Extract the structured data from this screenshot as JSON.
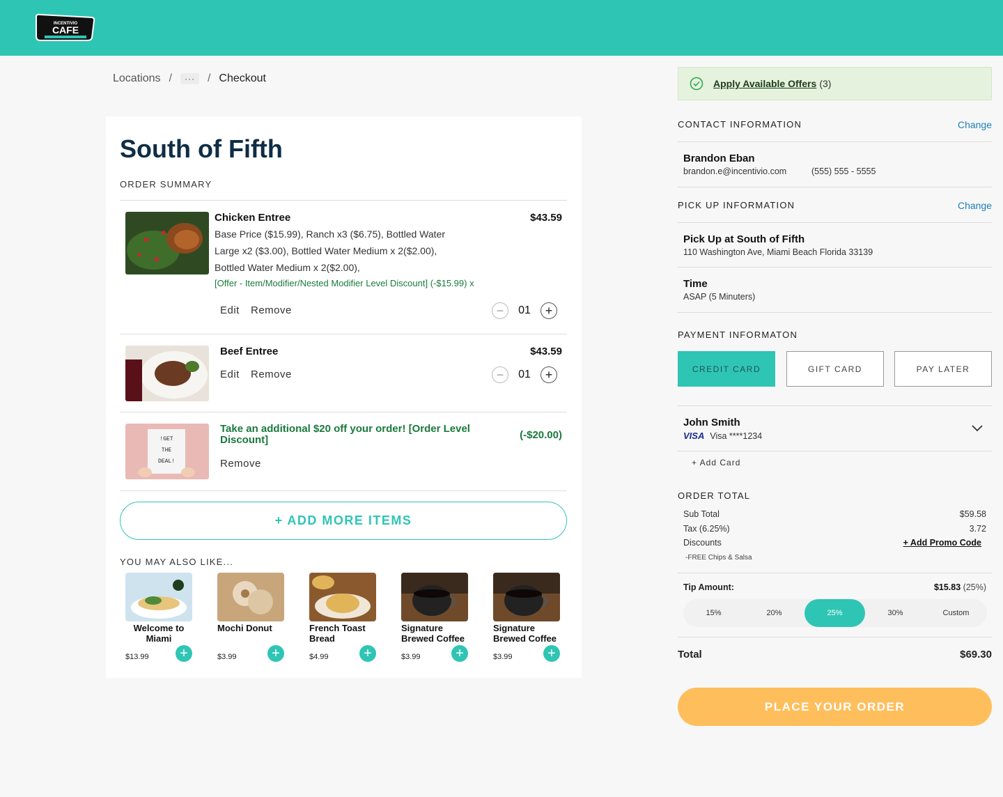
{
  "header": {
    "logo_alt": "Incentivio Cafe"
  },
  "breadcrumb": {
    "locations": "Locations",
    "sep": "/",
    "ellipsis": "···",
    "current": "Checkout"
  },
  "store": {
    "title": "South of Fifth"
  },
  "order_summary": {
    "label": "ORDER SUMMARY",
    "items": [
      {
        "name": "Chicken Entree",
        "price": "$43.59",
        "desc": "Base Price ($15.99), Ranch x3 ($6.75), Bottled Water Large x2 ($3.00), Bottled Water Medium x 2($2.00), Bottled Water Medium x 2($2.00),",
        "offer": "[Offer - Item/Modifier/Nested Modifier Level Discount] (-$15.99) x",
        "edit": "Edit",
        "remove": "Remove",
        "qty": "01"
      },
      {
        "name": "Beef Entree",
        "price": "$43.59",
        "edit": "Edit",
        "remove": "Remove",
        "qty": "01"
      }
    ],
    "discount": {
      "title": "Take an additional $20 off your order! [Order Level Discount]",
      "amount": "(-$20.00)",
      "remove": "Remove",
      "image_text": "!GET THE DEAL!"
    },
    "add_more": "+ ADD MORE ITEMS"
  },
  "recommendations": {
    "label": "YOU MAY ALSO LIKE...",
    "items": [
      {
        "name": "Welcome to Miami",
        "price": "$13.99"
      },
      {
        "name": "Mochi Donut",
        "price": "$3.99"
      },
      {
        "name": "French Toast Bread",
        "price": "$4.99"
      },
      {
        "name": "Signature Brewed Coffee",
        "price": "$3.99"
      },
      {
        "name": "Signature Brewed Coffee",
        "price": "$3.99"
      }
    ]
  },
  "offers": {
    "link": "Apply Available Offers",
    "count": "(3)"
  },
  "contact": {
    "label": "CONTACT INFORMATION",
    "change": "Change",
    "name": "Brandon Eban",
    "email": "brandon.e@incentivio.com",
    "phone": "(555) 555 - 5555"
  },
  "pickup": {
    "label": "PICK UP INFORMATION",
    "change": "Change",
    "title": "Pick Up at South of Fifth",
    "address": "110 Washington Ave, Miami Beach Florida 33139",
    "time_label": "Time",
    "time_value": "ASAP (5 Minuters)"
  },
  "payment": {
    "label": "PAYMENT INFORMATON",
    "options": [
      "CREDIT CARD",
      "GIFT CARD",
      "PAY LATER"
    ],
    "selected": "CREDIT CARD",
    "card_name": "John Smith",
    "card_brand": "VISA",
    "card_number": "Visa ****1234",
    "add_card": "+ Add Card"
  },
  "order_total": {
    "label": "ORDER TOTAL",
    "sub_total_label": "Sub Total",
    "sub_total": "$59.58",
    "tax_label": "Tax (6.25%)",
    "tax": "3.72",
    "discounts_label": "Discounts",
    "promo": "+ Add Promo Code",
    "free_item": "-FREE Chips & Salsa",
    "tip_label": "Tip Amount:",
    "tip_value": "$15.83",
    "tip_pct": "(25%)",
    "tip_options": [
      "15%",
      "20%",
      "25%",
      "30%",
      "Custom"
    ],
    "tip_selected": "25%",
    "total_label": "Total",
    "total": "$69.30"
  },
  "place_order": "PLACE YOUR ORDER",
  "colors": {
    "brand": "#2fc5b5",
    "cta": "#ffbe5c",
    "offer_green": "#1a7a3c",
    "title_navy": "#0f2d45"
  }
}
